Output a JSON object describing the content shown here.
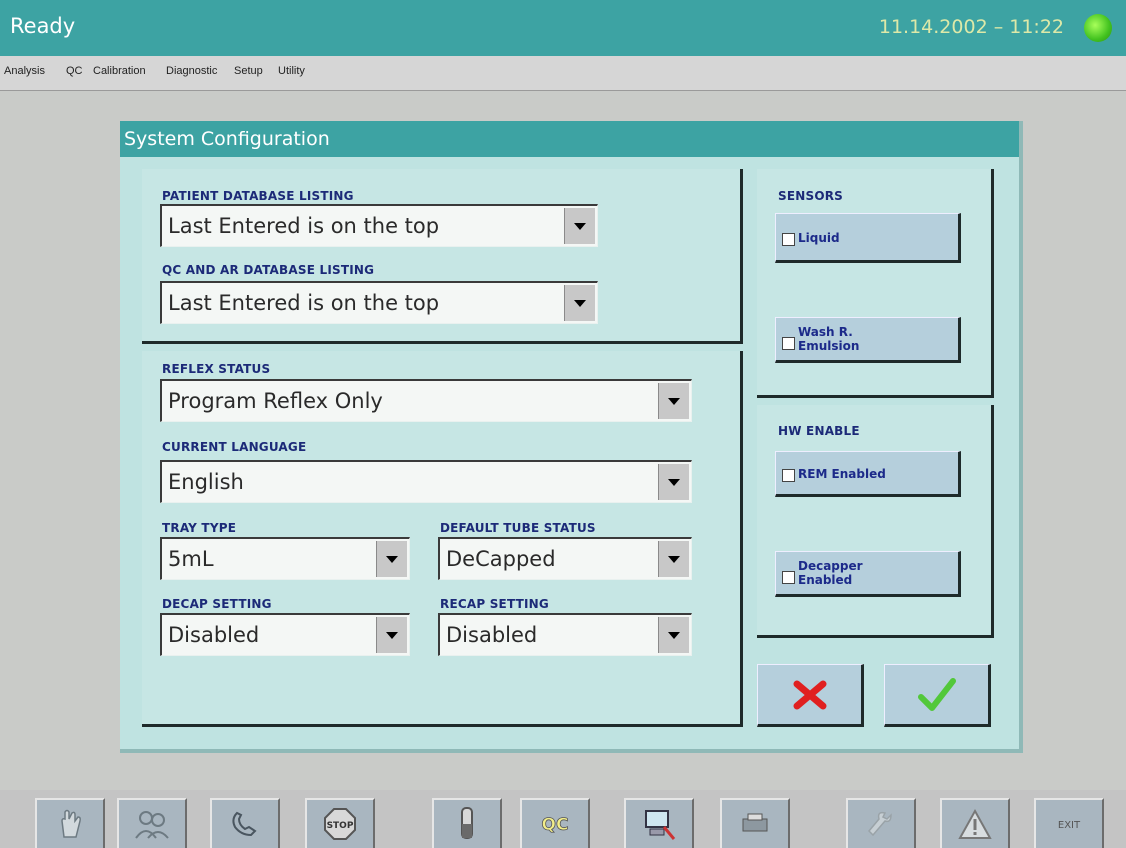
{
  "header": {
    "status": "Ready",
    "datetime": "11.14.2002 – 11:22",
    "indicator_color": "#42c21f"
  },
  "menu": [
    {
      "id": "analysis",
      "label": "Analysis"
    },
    {
      "id": "qc",
      "label": "QC"
    },
    {
      "id": "calibration",
      "label": "Calibration"
    },
    {
      "id": "diagnostic",
      "label": "Diagnostic"
    },
    {
      "id": "setup",
      "label": "Setup"
    },
    {
      "id": "utility",
      "label": "Utility"
    }
  ],
  "dialog": {
    "title": "System Configuration",
    "patient_db": {
      "label": "PATIENT DATABASE LISTING",
      "value": "Last Entered is on the top"
    },
    "qc_db": {
      "label": "QC AND AR DATABASE LISTING",
      "value": "Last Entered is on the top"
    },
    "reflex": {
      "label": "REFLEX STATUS",
      "value": "Program Reflex Only"
    },
    "language": {
      "label": "CURRENT LANGUAGE",
      "value": "English"
    },
    "tray": {
      "label": "TRAY TYPE",
      "value": "5mL"
    },
    "tube": {
      "label": "DEFAULT TUBE STATUS",
      "value": "DeCapped"
    },
    "decap": {
      "label": "DECAP SETTING",
      "value": "Disabled"
    },
    "recap": {
      "label": "RECAP SETTING",
      "value": "Disabled"
    },
    "sensors": {
      "label": "SENSORS",
      "liquid": "Liquid",
      "wash_l1": "Wash R.",
      "wash_l2": "Emulsion"
    },
    "hw": {
      "label": "HW ENABLE",
      "rem": "REM Enabled",
      "decapper_l1": "Decapper",
      "decapper_l2": "Enabled"
    },
    "cancel_color": "#e02020",
    "ok_color": "#52c83a"
  },
  "toolbar": [
    {
      "id": "tb-analysis",
      "icon": "hand-icon"
    },
    {
      "id": "tb-people",
      "icon": "people-icon"
    },
    {
      "id": "tb-phone",
      "icon": "phone-icon"
    },
    {
      "id": "tb-stop",
      "icon": "stop-icon",
      "text": "STOP"
    },
    {
      "id": "tb-tube",
      "icon": "tube-icon"
    },
    {
      "id": "tb-qc",
      "icon": "qc-icon",
      "text": "QC"
    },
    {
      "id": "tb-computer",
      "icon": "computer-icon"
    },
    {
      "id": "tb-printer",
      "icon": "printer-icon"
    },
    {
      "id": "tb-disabled",
      "icon": "wrench-icon"
    },
    {
      "id": "tb-warning",
      "icon": "warning-icon"
    },
    {
      "id": "tb-exit",
      "icon": "exit-icon",
      "text": "EXIT"
    }
  ]
}
